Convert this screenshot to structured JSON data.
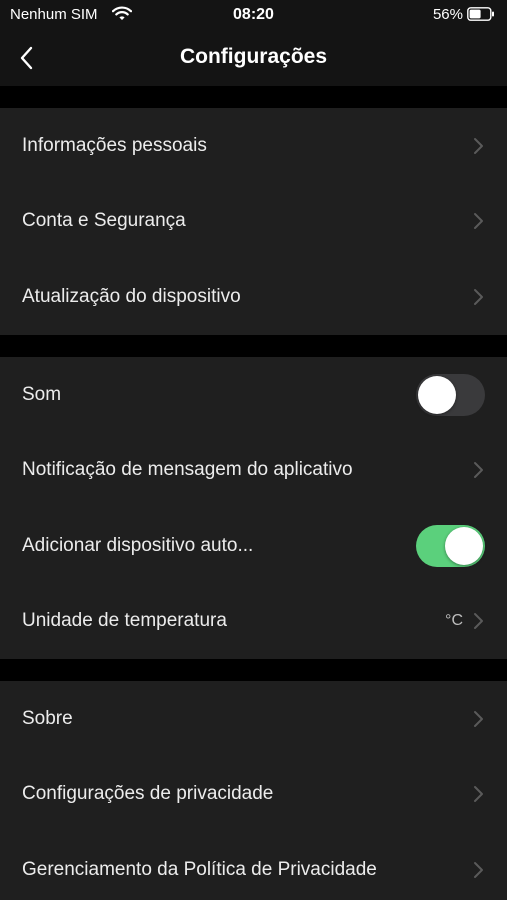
{
  "status_bar": {
    "carrier": "Nenhum SIM",
    "time": "08:20",
    "battery_pct": "56%",
    "battery_level": 0.56
  },
  "nav": {
    "title": "Configurações",
    "back_icon": "chevron-left-icon"
  },
  "groups": [
    {
      "items": [
        {
          "label": "Informações pessoais",
          "type": "link"
        },
        {
          "label": "Conta e Segurança",
          "type": "link"
        },
        {
          "label": "Atualização do dispositivo",
          "type": "link"
        }
      ]
    },
    {
      "items": [
        {
          "label": "Som",
          "type": "toggle",
          "on": false
        },
        {
          "label": "Notificação de mensagem do aplicativo",
          "type": "link"
        },
        {
          "label": "Adicionar dispositivo auto...",
          "type": "toggle",
          "on": true
        },
        {
          "label": "Unidade de temperatura",
          "type": "link",
          "value": "°C"
        }
      ]
    },
    {
      "items": [
        {
          "label": "Sobre",
          "type": "link"
        },
        {
          "label": "Configurações de privacidade",
          "type": "link"
        },
        {
          "label": "Gerenciamento da Política de Privacidade",
          "type": "link"
        }
      ]
    }
  ],
  "colors": {
    "background": "#000000",
    "cell": "#1f1f1f",
    "toggle_on": "#5bd07c",
    "toggle_off": "#3a3a3c",
    "chevron": "#5a5a5a"
  }
}
